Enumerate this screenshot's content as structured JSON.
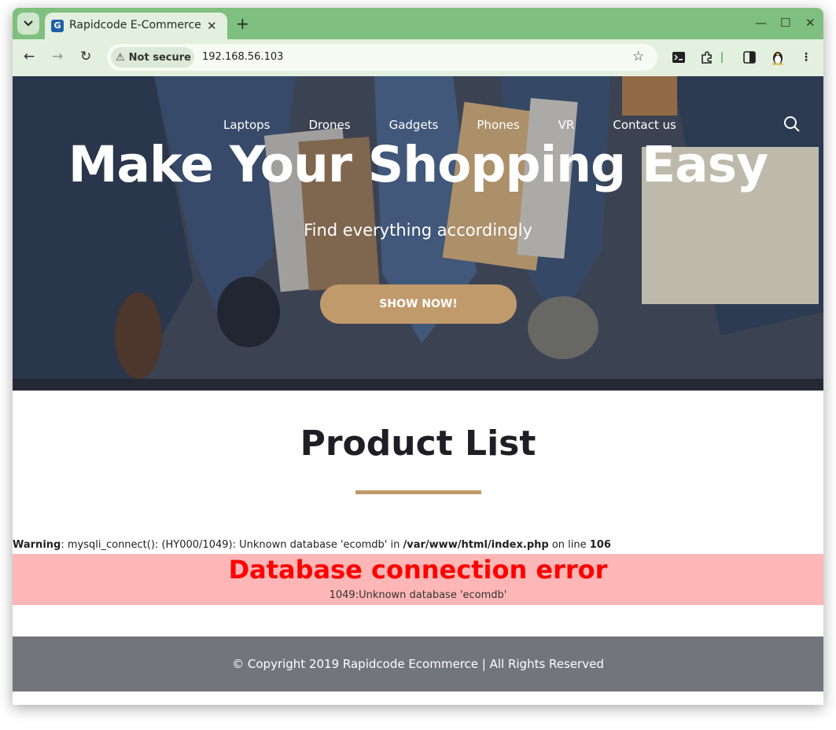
{
  "browser": {
    "tab_title": "Rapidcode E-Commerce",
    "tab_favicon_letter": "G",
    "security_label": "Not secure",
    "url": "192.168.56.103"
  },
  "site": {
    "nav": [
      "Laptops",
      "Drones",
      "Gadgets",
      "Phones",
      "VR",
      "Contact us"
    ],
    "hero_title": "Make Your Shopping Easy",
    "hero_subtitle": "Find everything accordingly",
    "hero_button": "SHOW NOW!",
    "section_title": "Product List"
  },
  "warning": {
    "label": "Warning",
    "message": ": mysqli_connect(): (HY000/1049): Unknown database 'ecomdb' in ",
    "file": "/var/www/html/index.php",
    "on_line": " on line ",
    "line": "106"
  },
  "error": {
    "title": "Database connection error",
    "detail": "1049:Unknown database 'ecomdb'"
  },
  "footer": {
    "text": "© Copyright 2019 Rapidcode Ecommerce | All Rights Reserved"
  },
  "colors": {
    "accent": "#c19a6b",
    "error_bg": "#ffb6b6",
    "error_text": "#ff0000",
    "footer_bg": "#73757d",
    "browser_frame": "#7fbf7f"
  }
}
